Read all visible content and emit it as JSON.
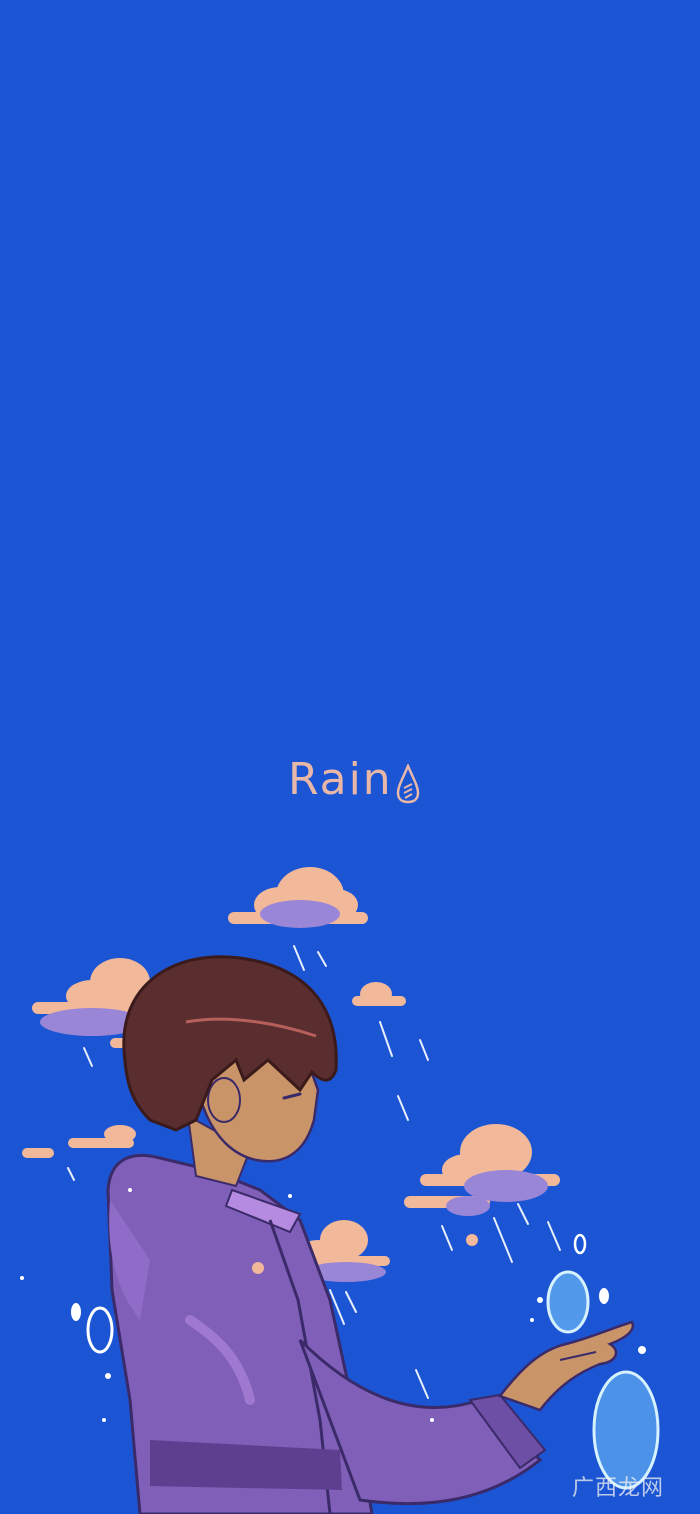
{
  "wallpaper": {
    "title": "Rain",
    "title_icon": "raindrop-icon",
    "watermark": "广西龙网",
    "colors": {
      "background": "#1b55d3",
      "title": "#e9b7a8",
      "cloud_peach": "#f1b89a",
      "cloud_lilac": "#9a86d6",
      "hoodie": "#7f5fb8",
      "hair": "#5a2d2e",
      "skin": "#c99468",
      "water": "#7fd0ff"
    }
  }
}
